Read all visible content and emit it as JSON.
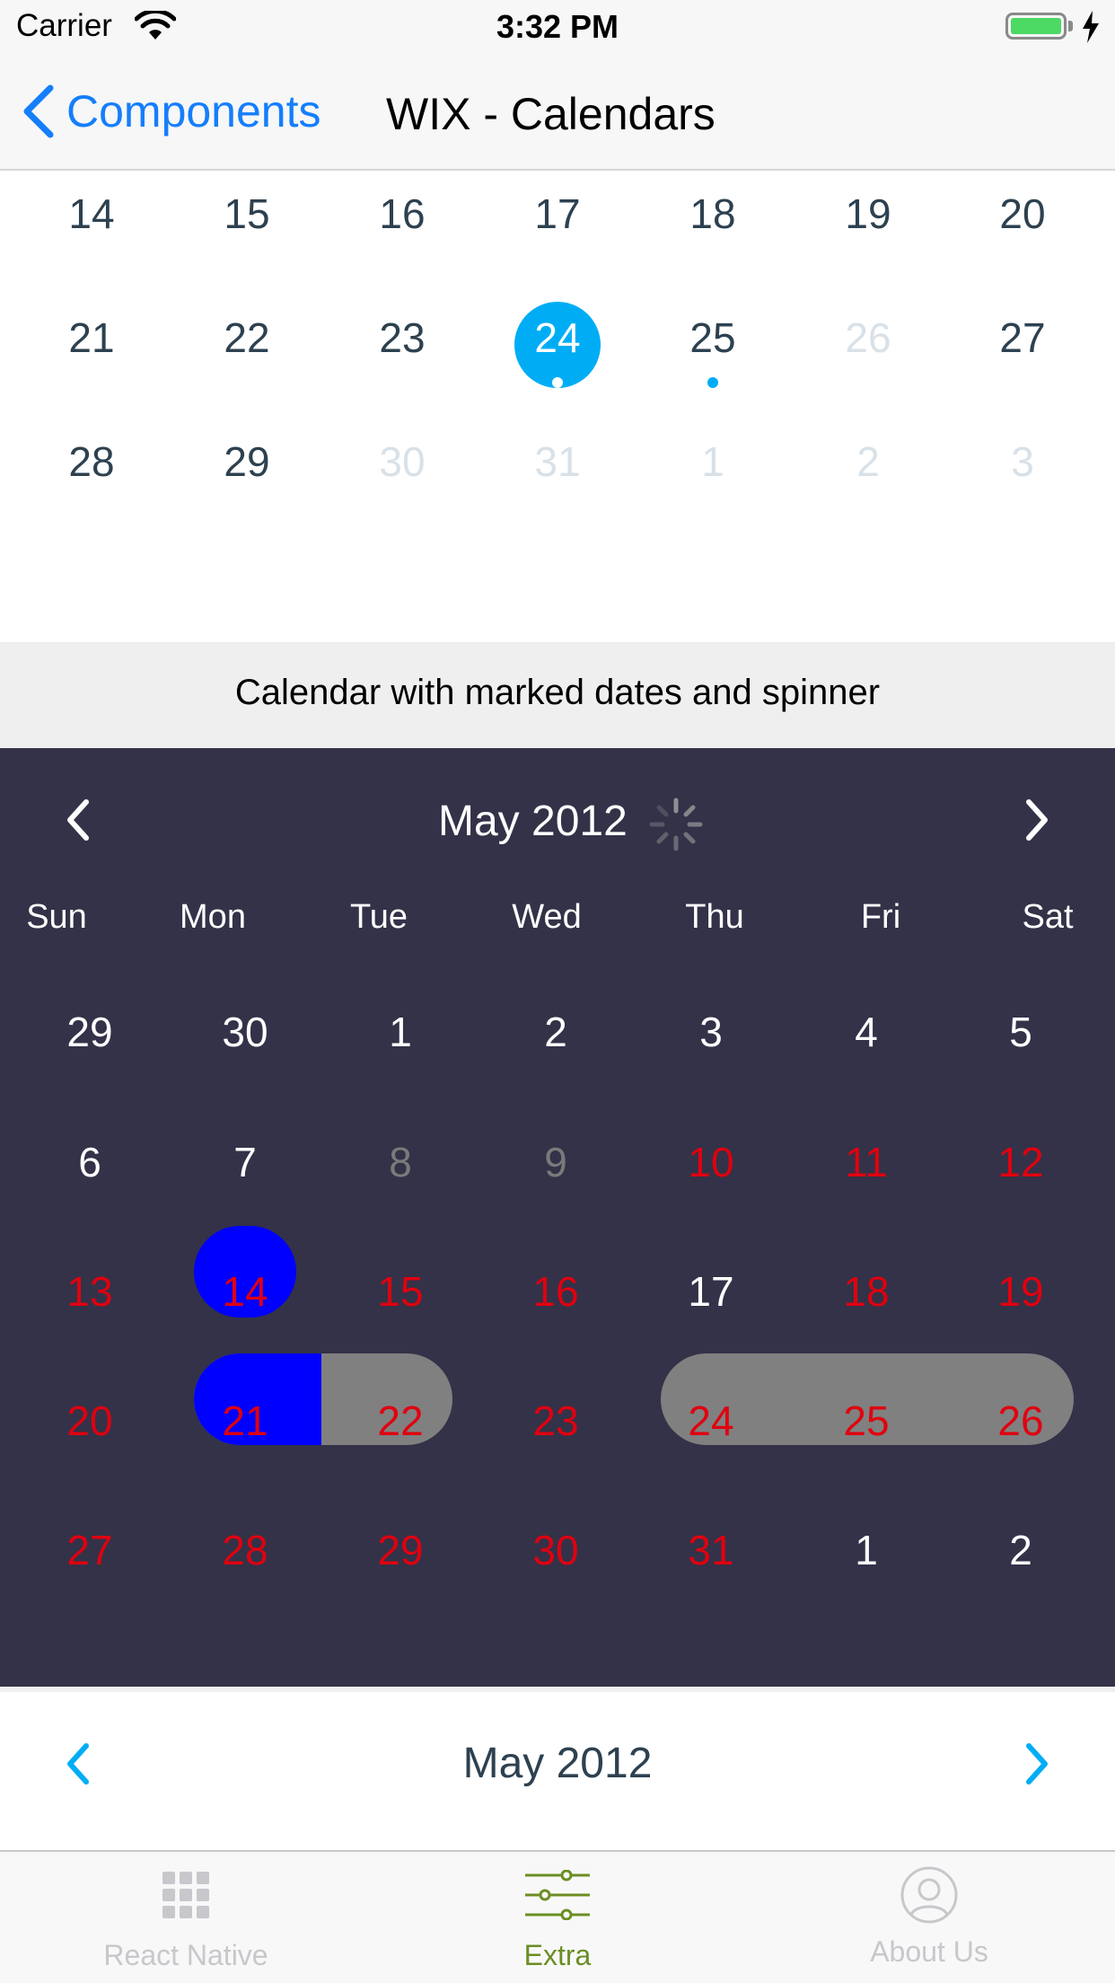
{
  "status_bar": {
    "carrier": "Carrier",
    "time": "3:32 PM"
  },
  "nav": {
    "back_label": "Components",
    "title": "WIX - Calendars"
  },
  "calendar_top": {
    "weeks": [
      [
        "14",
        "15",
        "16",
        "17",
        "18",
        "19",
        "20"
      ],
      [
        "21",
        "22",
        "23",
        "24",
        "25",
        "26",
        "27"
      ],
      [
        "28",
        "29",
        "30",
        "31",
        "1",
        "2",
        "3"
      ]
    ],
    "selected_day": "24",
    "marked_days": [
      "24",
      "25"
    ],
    "disabled_days": [
      "26"
    ],
    "colors": {
      "selected": "#00adf5",
      "text": "#2d4150",
      "disabled": "#d9e1e8"
    }
  },
  "section_header": "Calendar with marked dates and spinner",
  "calendar_dark": {
    "month_title": "May 2012",
    "loading": true,
    "day_names": [
      "Sun",
      "Mon",
      "Tue",
      "Wed",
      "Thu",
      "Fri",
      "Sat"
    ],
    "weeks": [
      [
        "29",
        "30",
        "1",
        "2",
        "3",
        "4",
        "5"
      ],
      [
        "6",
        "7",
        "8",
        "9",
        "10",
        "11",
        "12"
      ],
      [
        "13",
        "14",
        "15",
        "16",
        "17",
        "18",
        "19"
      ],
      [
        "20",
        "21",
        "22",
        "23",
        "24",
        "25",
        "26"
      ],
      [
        "27",
        "28",
        "29",
        "30",
        "31",
        "1",
        "2"
      ]
    ],
    "colors": {
      "background": "#333248",
      "text": "#ffffff",
      "marked": "#e0000f",
      "disabled": "#7a7a7a",
      "selected": "#0000ff",
      "period": "#808080"
    }
  },
  "calendar_bottom": {
    "month_title": "May 2012",
    "colors": {
      "arrow": "#00adf5",
      "text": "#2d4150"
    }
  },
  "tab_bar": {
    "tabs": [
      {
        "label": "React Native",
        "icon": "grid-icon",
        "active": false
      },
      {
        "label": "Extra",
        "icon": "sliders-icon",
        "active": true
      },
      {
        "label": "About Us",
        "icon": "person-icon",
        "active": false
      }
    ],
    "colors": {
      "active": "#6b8e23",
      "inactive": "#c7c7cc"
    }
  }
}
